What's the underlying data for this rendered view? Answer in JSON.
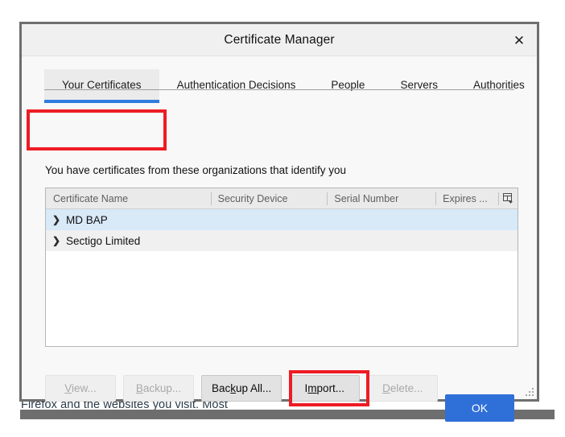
{
  "backdrop": {
    "visible_text": "Firefox and the websites you visit. Most"
  },
  "dialog": {
    "title": "Certificate Manager",
    "close_icon": "close-icon",
    "close_glyph": "✕",
    "description": "You have certificates from these organizations that identify you",
    "tabs": [
      {
        "label": "Your Certificates",
        "active": true
      },
      {
        "label": "Authentication Decisions",
        "active": false
      },
      {
        "label": "People",
        "active": false
      },
      {
        "label": "Servers",
        "active": false
      },
      {
        "label": "Authorities",
        "active": false
      }
    ],
    "table": {
      "columns": [
        "Certificate Name",
        "Security Device",
        "Serial Number",
        "Expires ..."
      ],
      "column_picker_icon": "column-picker-icon",
      "rows": [
        {
          "name": "MD BAP",
          "selected": true,
          "twisty": "❯"
        },
        {
          "name": "Sectigo Limited",
          "selected": false,
          "twisty": "❯"
        }
      ]
    },
    "buttons": [
      {
        "label": "View...",
        "mnemonic": "V",
        "enabled": false
      },
      {
        "label": "Backup...",
        "mnemonic": "B",
        "enabled": false
      },
      {
        "label": "Backup All...",
        "mnemonic": "k",
        "enabled": true
      },
      {
        "label": "Import...",
        "mnemonic": "m",
        "enabled": true
      },
      {
        "label": "Delete...",
        "mnemonic": "D",
        "enabled": false
      }
    ],
    "ok_label": "OK",
    "resize_grip_icon": "resize-grip-icon"
  },
  "annotations": {
    "highlight_color": "#ed1c24",
    "boxes": [
      {
        "target": "Your Certificates tab"
      },
      {
        "target": "Import... button"
      }
    ]
  },
  "colors": {
    "accent_blue": "#2f6fd8",
    "tab_underline": "#2f7ce0",
    "row_selected": "#d8e9f8",
    "dialog_border": "#6e6e6e"
  }
}
